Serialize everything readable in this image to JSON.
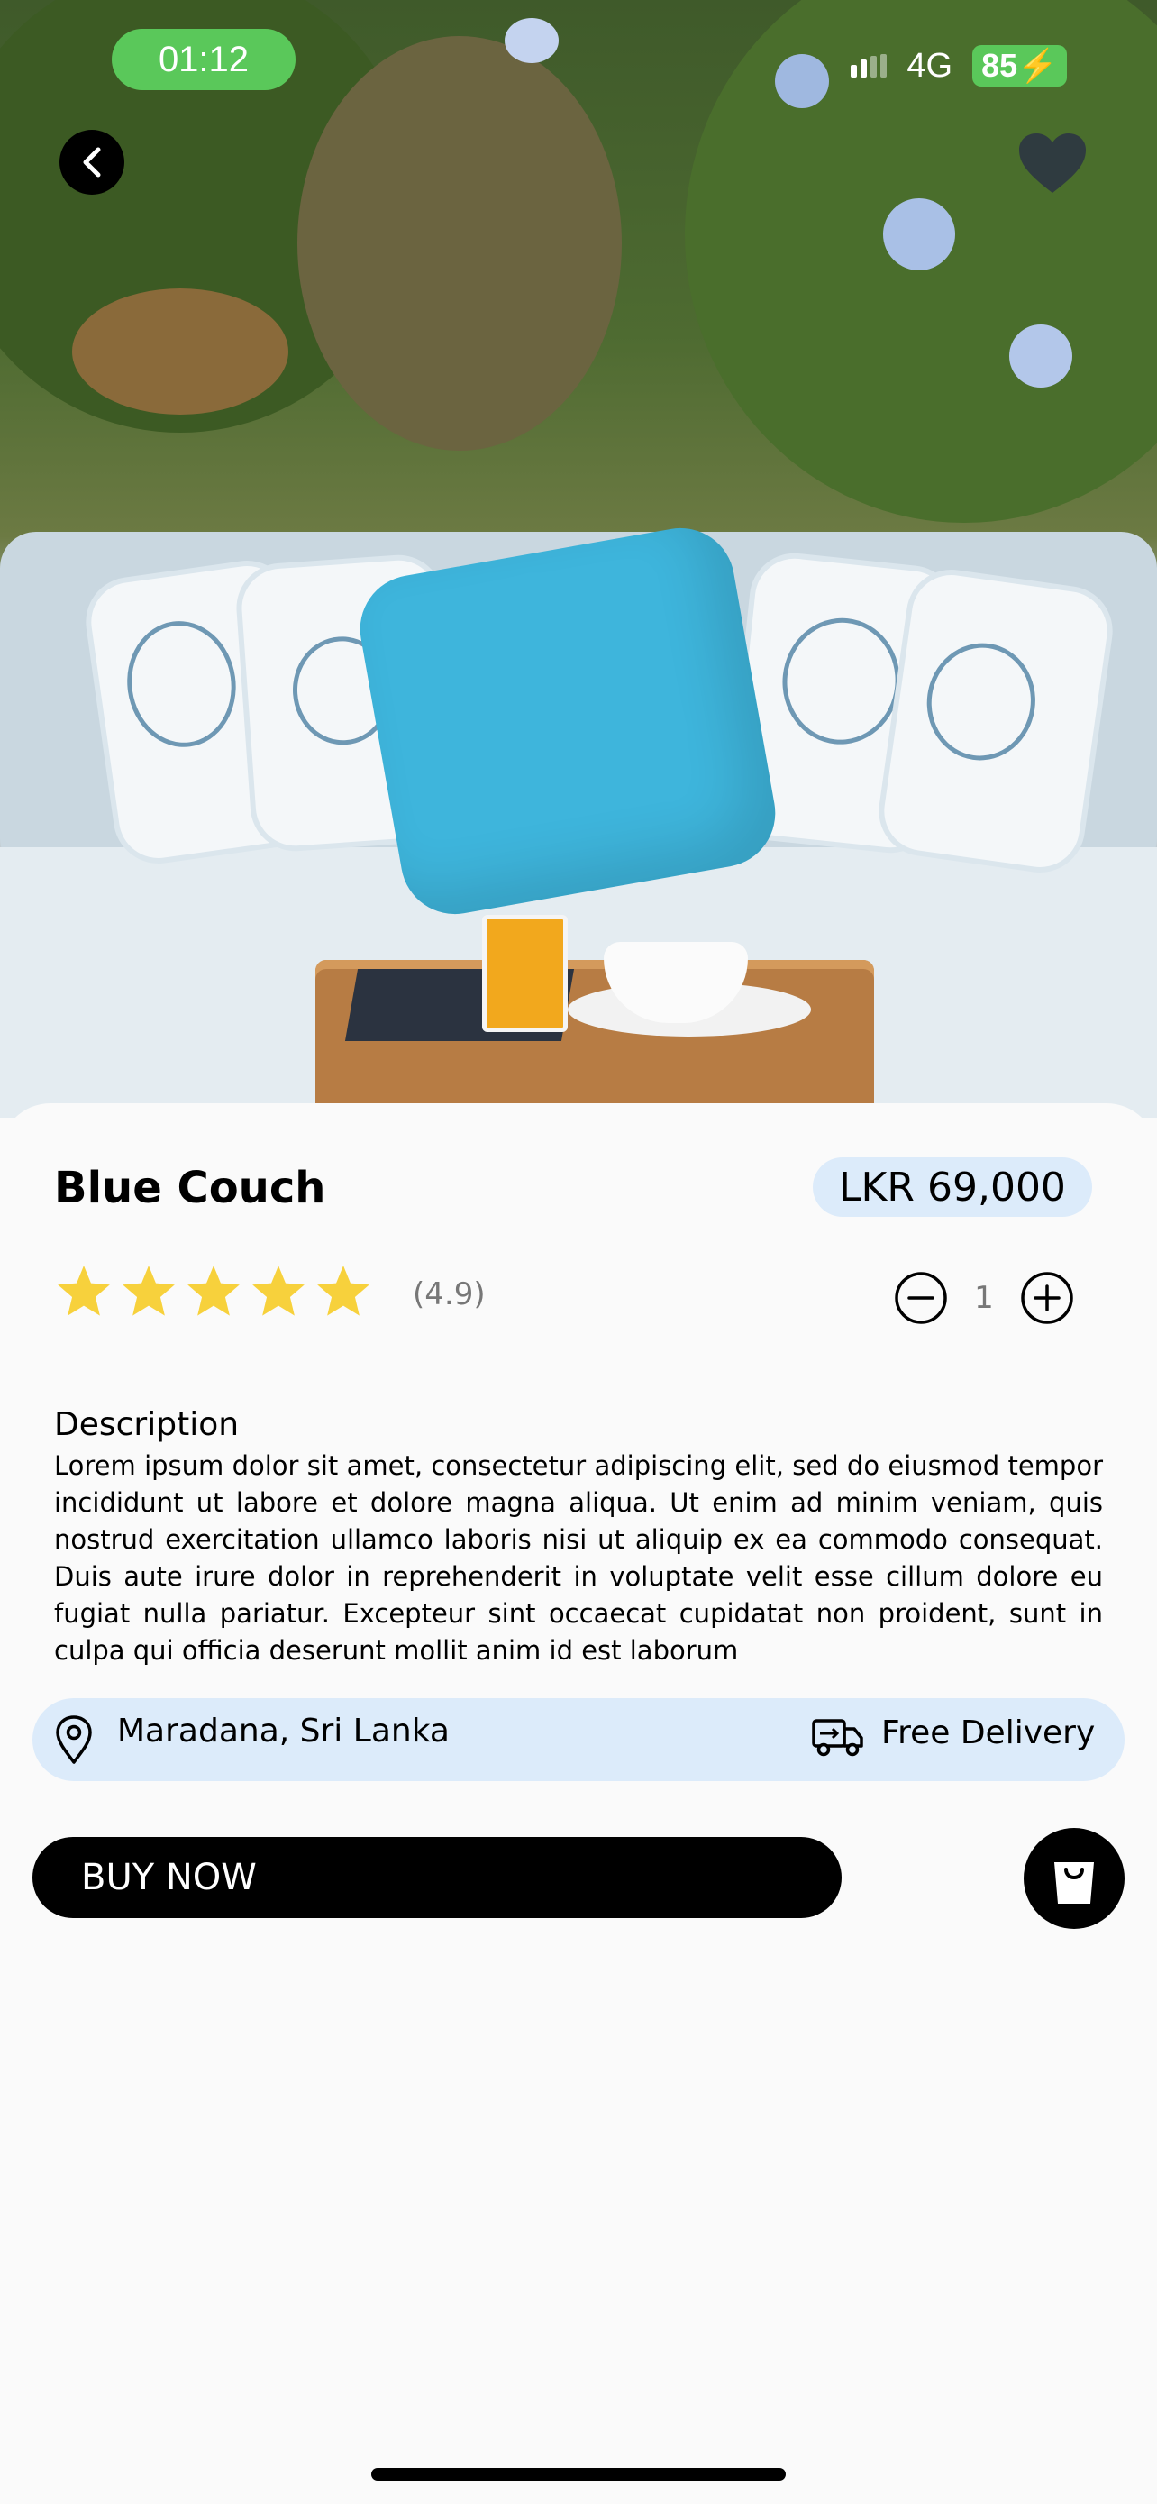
{
  "status_bar": {
    "time": "01:12",
    "network": "4G",
    "battery": "85"
  },
  "product": {
    "name": "Blue Couch",
    "price": "LKR 69,000",
    "rating_text": "(4.9)",
    "rating_value": 4.9,
    "stars_filled": 5,
    "quantity": "1"
  },
  "description": {
    "heading": "Description",
    "body": "Lorem ipsum dolor sit amet, consectetur adipiscing elit, sed do eiusmod tempor incididunt ut labore et dolore magna aliqua. Ut enim ad minim veniam, quis nostrud exercitation ullamco laboris nisi ut aliquip ex ea commodo consequat. Duis aute irure dolor in reprehenderit in voluptate velit esse cillum dolore eu fugiat nulla pariatur. Excepteur sint occaecat cupidatat non proident, sunt in culpa qui officia deserunt mollit anim id est laborum"
  },
  "info": {
    "location": "Maradana, Sri Lanka",
    "delivery": "Free Delivery"
  },
  "actions": {
    "buy_label": "BUY NOW"
  },
  "icons": {
    "back": "chevron-left-icon",
    "favorite": "heart-icon",
    "location": "map-pin-icon",
    "delivery": "truck-icon",
    "cart": "shopping-bag-icon",
    "decrement": "minus-circle-icon",
    "increment": "plus-circle-icon",
    "rating": "star-icon"
  },
  "colors": {
    "time_pill": "#5ac85a",
    "price_badge": "#dcebfa",
    "info_bar": "#dcebfa",
    "star": "#f7d13c",
    "buy_button": "#000000"
  }
}
